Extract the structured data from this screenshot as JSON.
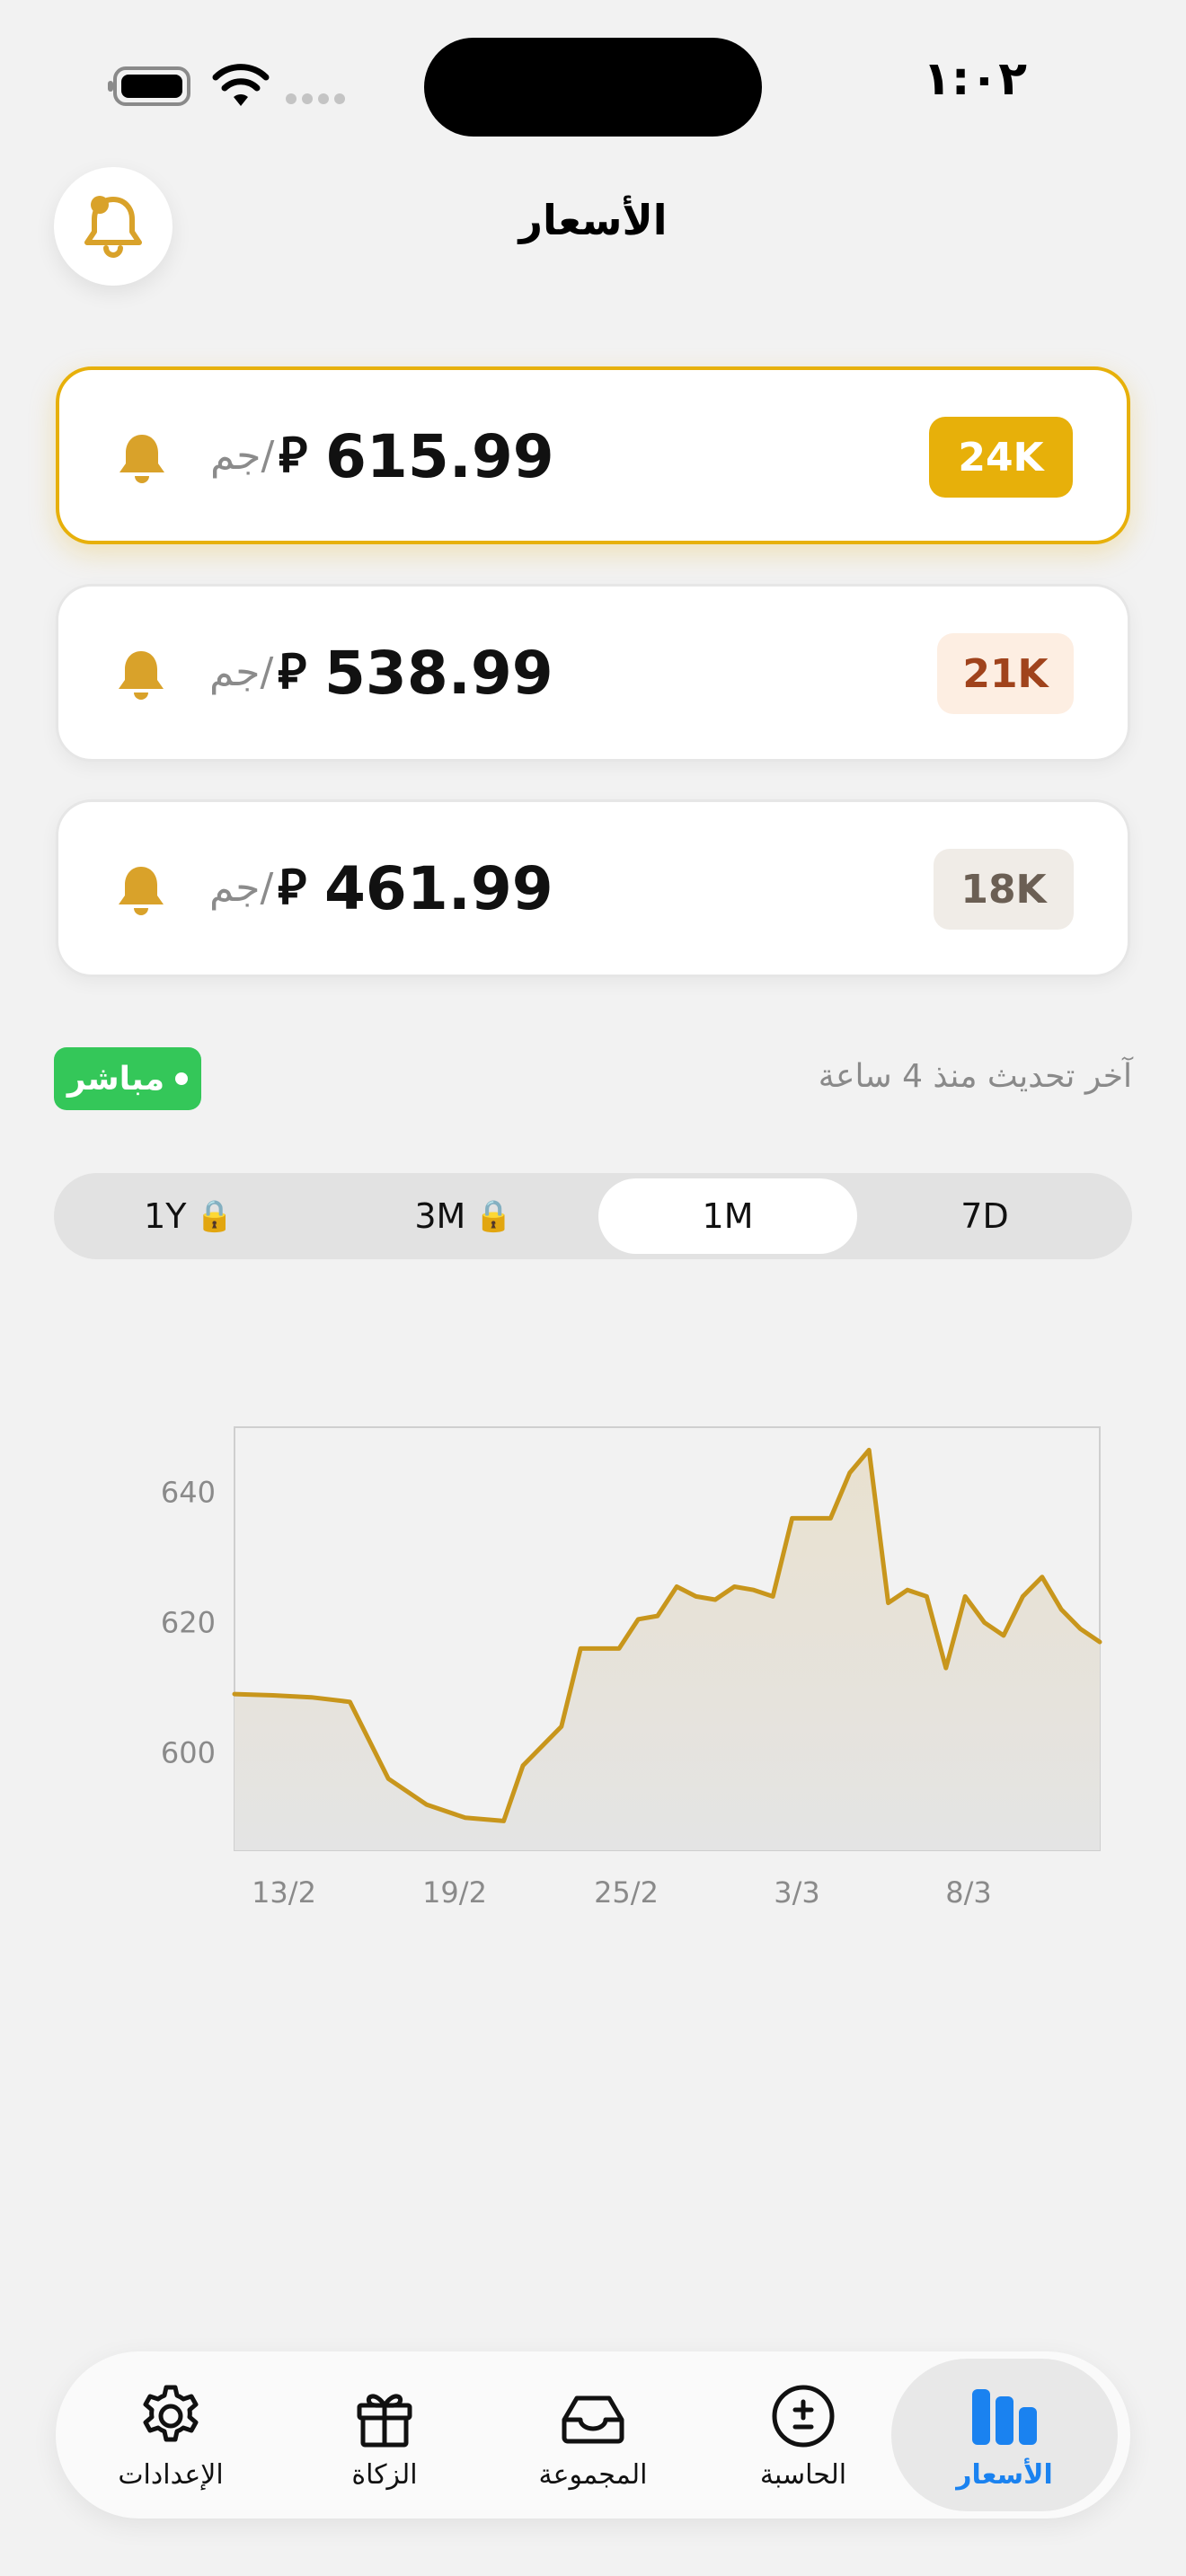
{
  "status_bar": {
    "time": "١:٠٢"
  },
  "header": {
    "title": "الأسعار"
  },
  "prices": [
    {
      "karat": "24K",
      "value": "615.99",
      "currency": "⃁",
      "unit": "/جم",
      "badge_bg": "#e7b00a",
      "badge_fg": "#ffffff"
    },
    {
      "karat": "21K",
      "value": "538.99",
      "currency": "⃁",
      "unit": "/جم",
      "badge_bg": "#fdeee2",
      "badge_fg": "#a0431c"
    },
    {
      "karat": "18K",
      "value": "461.99",
      "currency": "⃁",
      "unit": "/جم",
      "badge_bg": "#f0ece7",
      "badge_fg": "#6b5f54"
    }
  ],
  "live": {
    "label": "مباشر",
    "updated": "آخر تحديث منذ 4 ساعة"
  },
  "periods": [
    {
      "label": "1Y",
      "locked": true
    },
    {
      "label": "3M",
      "locked": true
    },
    {
      "label": "1M",
      "locked": false,
      "selected": true
    },
    {
      "label": "7D",
      "locked": false
    }
  ],
  "chart_data": {
    "type": "area",
    "x_tick_labels": [
      "13/2",
      "19/2",
      "25/2",
      "3/3",
      "8/3"
    ],
    "y_ticks": [
      600,
      620,
      640
    ],
    "ylim": [
      585,
      650
    ],
    "line_color": "#c8961c",
    "points": [
      [
        0,
        609
      ],
      [
        2,
        608.8
      ],
      [
        4,
        608.5
      ],
      [
        6,
        607.8
      ],
      [
        8,
        596
      ],
      [
        10,
        592
      ],
      [
        12,
        590
      ],
      [
        14,
        589.5
      ],
      [
        15,
        598
      ],
      [
        17,
        604
      ],
      [
        18,
        616
      ],
      [
        20,
        616
      ],
      [
        21,
        620.5
      ],
      [
        22,
        621
      ],
      [
        23,
        625.5
      ],
      [
        24,
        624
      ],
      [
        25,
        623.5
      ],
      [
        26,
        625.5
      ],
      [
        27,
        625
      ],
      [
        28,
        624
      ],
      [
        29,
        636
      ],
      [
        30,
        636
      ],
      [
        31,
        636
      ],
      [
        32,
        643
      ],
      [
        33,
        646.5
      ],
      [
        34,
        623
      ],
      [
        35,
        625
      ],
      [
        36,
        624
      ],
      [
        37,
        613
      ],
      [
        38,
        624
      ],
      [
        39,
        620
      ],
      [
        40,
        618
      ],
      [
        41,
        624
      ],
      [
        42,
        627
      ],
      [
        43,
        622
      ],
      [
        44,
        619
      ],
      [
        45,
        617
      ]
    ]
  },
  "tabs": [
    {
      "label": "الإعدادات",
      "icon": "gear-icon"
    },
    {
      "label": "الزكاة",
      "icon": "gift-icon"
    },
    {
      "label": "المجموعة",
      "icon": "tray-icon"
    },
    {
      "label": "الحاسبة",
      "icon": "plus-minus-icon"
    },
    {
      "label": "الأسعار",
      "icon": "bar-chart-icon",
      "selected": true
    }
  ],
  "colors": {
    "accent": "#e7b00a",
    "bell": "#d9a22a",
    "live": "#34c759",
    "tab_active": "#1a82f0"
  }
}
